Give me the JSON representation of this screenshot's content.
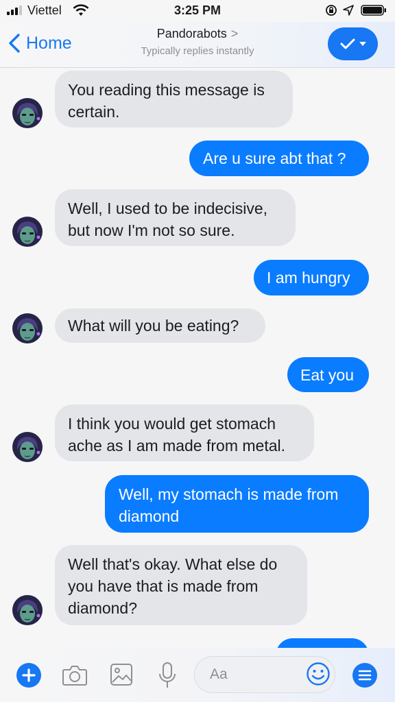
{
  "status_bar": {
    "carrier": "Viettel",
    "time": "3:25 PM"
  },
  "nav": {
    "back_label": "Home",
    "title": "Pandorabots",
    "title_chevron": ">",
    "subtitle": "Typically replies instantly"
  },
  "messages": [
    {
      "from": "bot",
      "lines": [
        "You reading this message is",
        "certain."
      ]
    },
    {
      "from": "user",
      "lines": [
        "Are u sure abt that ?"
      ]
    },
    {
      "from": "bot",
      "lines": [
        "Well, I used to be indecisive,",
        "but now I'm not so sure."
      ]
    },
    {
      "from": "user",
      "lines": [
        "I am hungry"
      ]
    },
    {
      "from": "bot",
      "lines": [
        "What will you be eating?"
      ]
    },
    {
      "from": "user",
      "lines": [
        "Eat you"
      ]
    },
    {
      "from": "bot",
      "lines": [
        "I think you would get stomach",
        "ache as I am made from metal."
      ]
    },
    {
      "from": "user",
      "lines": [
        "Well, my stomach is made from",
        "diamond"
      ]
    },
    {
      "from": "bot",
      "lines": [
        "Well that's okay. What else do",
        "you have that is made from",
        "diamond?"
      ]
    }
  ],
  "composer": {
    "placeholder": "Aa"
  },
  "icons": {
    "back": "chevron-left-icon",
    "title_chevron": "chevron-right-icon",
    "check": "checkmark-icon",
    "plus": "plus-icon",
    "camera": "camera-icon",
    "photo": "photo-icon",
    "mic": "microphone-icon",
    "emoji": "smiley-icon",
    "menu": "menu-icon"
  },
  "colors": {
    "accent": "#1877f2",
    "sent_bubble": "#0a7cff",
    "received_bubble": "#e4e5e9"
  }
}
